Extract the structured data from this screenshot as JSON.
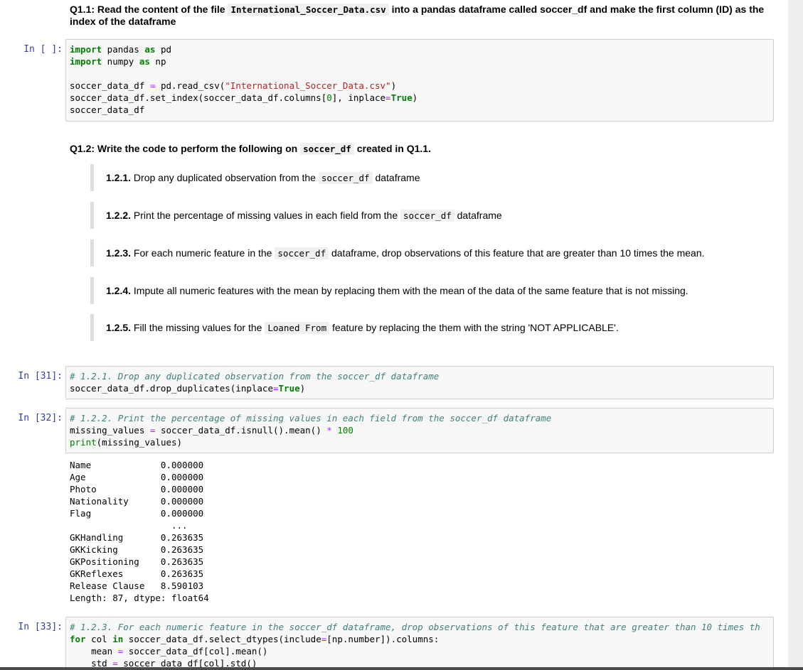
{
  "q1_1": {
    "prefix": "Q1.1: Read the content of the file ",
    "code": "International_Soccer_Data.csv",
    "suffix": " into a pandas dataframe called soccer_df and make the first column (ID) as the index of the dataframe"
  },
  "cell0": {
    "prompt": "In [ ]:",
    "line1_kw1": "import",
    "line1_mid": " pandas ",
    "line1_kw2": "as",
    "line1_end": " pd",
    "line2_kw1": "import",
    "line2_mid": " numpy ",
    "line2_kw2": "as",
    "line2_end": " np",
    "line4_a": "soccer_data_df ",
    "line4_op": "=",
    "line4_b": " pd.read_csv(",
    "line4_str": "\"International_Soccer_Data.csv\"",
    "line4_c": ")",
    "line5_a": "soccer_data_df.set_index(soccer_data_df.columns[",
    "line5_num": "0",
    "line5_b": "], inplace",
    "line5_op": "=",
    "line5_kw": "True",
    "line5_c": ")",
    "line6": "soccer_data_df"
  },
  "q1_2": {
    "prefix": "Q1.2: Write the code to perform the following on ",
    "code": "soccer_df",
    "suffix": " created in Q1.1."
  },
  "subtasks": [
    {
      "num": "1.2.1.",
      "before": " Drop any duplicated observation from the ",
      "code": "soccer_df",
      "after": " dataframe"
    },
    {
      "num": "1.2.2.",
      "before": " Print the percentage of missing values in each field from the ",
      "code": "soccer_df",
      "after": " dataframe"
    },
    {
      "num": "1.2.3.",
      "before": " For each numeric feature in the ",
      "code": "soccer_df",
      "after": " dataframe, drop observations of this feature that are greater than 10 times the mean."
    },
    {
      "num": "1.2.4.",
      "before": " Impute all numeric features with the mean by replacing them with the mean of the data of the same feature that is not missing.",
      "code": "",
      "after": ""
    },
    {
      "num": "1.2.5.",
      "before": " Fill the missing values for the ",
      "code": "Loaned From",
      "after": " feature by replacing the them with the string 'NOT APPLICABLE'."
    }
  ],
  "cell31": {
    "prompt": "In [31]:",
    "comment": "# 1.2.1. Drop any duplicated observation from the soccer_df dataframe",
    "line2_a": "soccer_data_df.drop_duplicates(inplace",
    "line2_op": "=",
    "line2_kw": "True",
    "line2_b": ")"
  },
  "cell32": {
    "prompt": "In [32]:",
    "comment": "# 1.2.2. Print the percentage of missing values in each field from the soccer_df dataframe",
    "line2_a": "missing_values ",
    "line2_op1": "=",
    "line2_b": " soccer_data_df.isnull().mean() ",
    "line2_op2": "*",
    "line2_sp": " ",
    "line2_num": "100",
    "line3_fn": "print",
    "line3_b": "(missing_values)"
  },
  "output32": "Name             0.000000\nAge              0.000000\nPhoto            0.000000\nNationality      0.000000\nFlag             0.000000\n                   ...   \nGKHandling       0.263635\nGKKicking        0.263635\nGKPositioning    0.263635\nGKReflexes       0.263635\nRelease Clause   8.590103\nLength: 87, dtype: float64",
  "cell33": {
    "prompt": "In [33]:",
    "comment": "# 1.2.3. For each numeric feature in the soccer_df dataframe, drop observations of this feature that are greater than 10 times th",
    "line2_kw1": "for",
    "line2_a": " col ",
    "line2_kw2": "in",
    "line2_b": " soccer_data_df.select_dtypes(include",
    "line2_op": "=",
    "line2_c": "[np.number]).columns:",
    "line3_a": "    mean ",
    "line3_op": "=",
    "line3_b": " soccer_data_df[col].mean()",
    "line4_a": "    std ",
    "line4_op": "=",
    "line4_b": " soccer_data_df[col].std()"
  },
  "colors": {
    "prompt": "#303f9f",
    "keyword": "#008000",
    "comment": "#408080",
    "string": "#ba2121",
    "operator": "#aa22ff"
  }
}
